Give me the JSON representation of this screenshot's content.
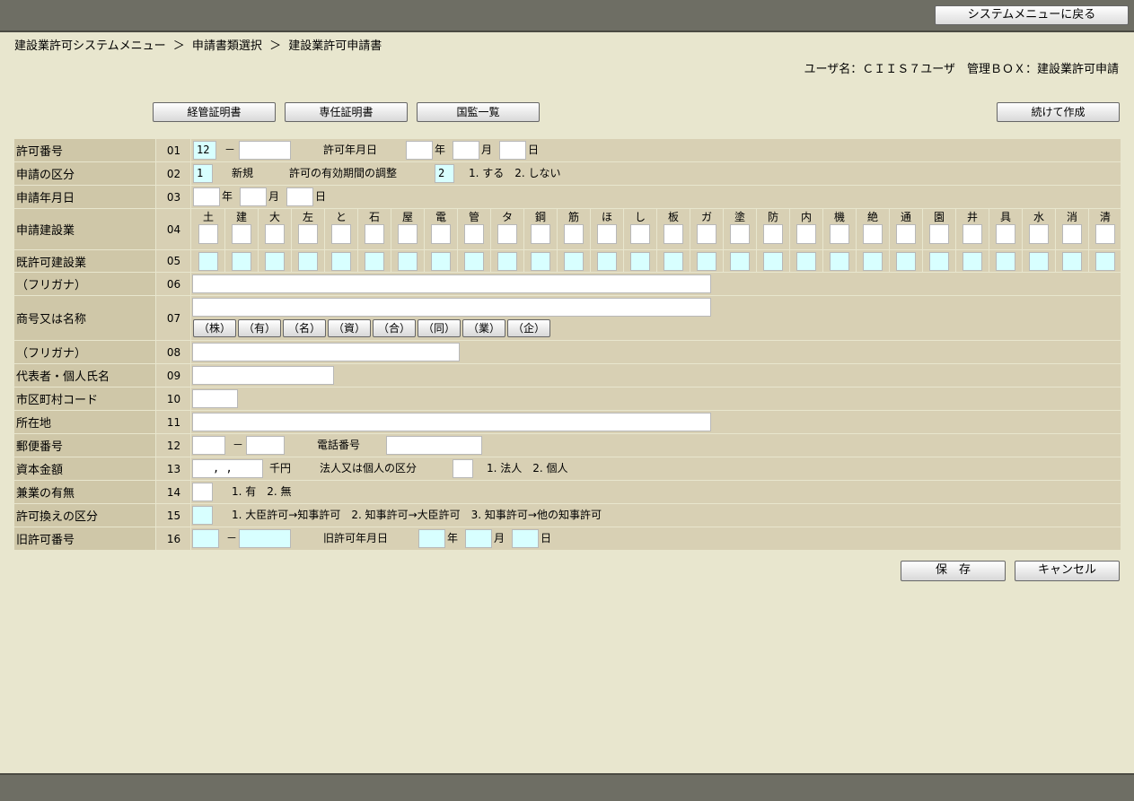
{
  "header": {
    "system_menu_button": "システムメニューに戻る"
  },
  "breadcrumb": [
    "建設業許可システムメニュー",
    "＞",
    "申請書類選択",
    "＞",
    "建設業許可申請書"
  ],
  "user_info": "ユーザ名：ＣＩＩＳ７ユーザ　管理ＢＯＸ：建設業許可申請",
  "toolbar": {
    "b1": "経管証明書",
    "b2": "専任証明書",
    "b3": "国監一覧",
    "continue": "続けて作成"
  },
  "rows": {
    "r01": {
      "label": "許可番号",
      "num": "01",
      "value": "12",
      "dash": "－",
      "date_label": "許可年月日",
      "y": "年",
      "m": "月",
      "d": "日"
    },
    "r02": {
      "label": "申請の区分",
      "num": "02",
      "value": "1",
      "opt": "新規",
      "adjust_label": "許可の有効期間の調整",
      "adjust_value": "2",
      "adjust_opts": "1. する　2. しない"
    },
    "r03": {
      "label": "申請年月日",
      "num": "03",
      "y": "年",
      "m": "月",
      "d": "日"
    },
    "r04": {
      "label": "申請建設業",
      "num": "04"
    },
    "r05": {
      "label": "既許可建設業",
      "num": "05"
    },
    "r06": {
      "label": "（フリガナ）",
      "num": "06"
    },
    "r07": {
      "label": "商号又は名称",
      "num": "07"
    },
    "r08": {
      "label": "（フリガナ）",
      "num": "08"
    },
    "r09": {
      "label": "代表者・個人氏名",
      "num": "09"
    },
    "r10": {
      "label": "市区町村コード",
      "num": "10"
    },
    "r11": {
      "label": "所在地",
      "num": "11"
    },
    "r12": {
      "label": "郵便番号",
      "num": "12",
      "dash": "－",
      "tel_label": "電話番号"
    },
    "r13": {
      "label": "資本金額",
      "num": "13",
      "value": " ,  ,",
      "unit": "千円",
      "kubun_label": "法人又は個人の区分",
      "kubun_opts": "1. 法人　2. 個人"
    },
    "r14": {
      "label": "兼業の有無",
      "num": "14",
      "opts": "1. 有　2. 無"
    },
    "r15": {
      "label": "許可換えの区分",
      "num": "15",
      "opts": "1. 大臣許可→知事許可　2. 知事許可→大臣許可　3. 知事許可→他の知事許可"
    },
    "r16": {
      "label": "旧許可番号",
      "num": "16",
      "dash": "－",
      "date_label": "旧許可年月日",
      "y": "年",
      "m": "月",
      "d": "日"
    }
  },
  "gyoshu": [
    "土",
    "建",
    "大",
    "左",
    "と",
    "石",
    "屋",
    "電",
    "管",
    "タ",
    "鋼",
    "筋",
    "ほ",
    "し",
    "板",
    "ガ",
    "塗",
    "防",
    "内",
    "機",
    "絶",
    "通",
    "園",
    "井",
    "具",
    "水",
    "消",
    "清"
  ],
  "kabushiki": [
    "（株）",
    "（有）",
    "（名）",
    "（資）",
    "（合）",
    "（同）",
    "（業）",
    "（企）"
  ],
  "footer": {
    "save": "保　存",
    "cancel": "キャンセル"
  }
}
